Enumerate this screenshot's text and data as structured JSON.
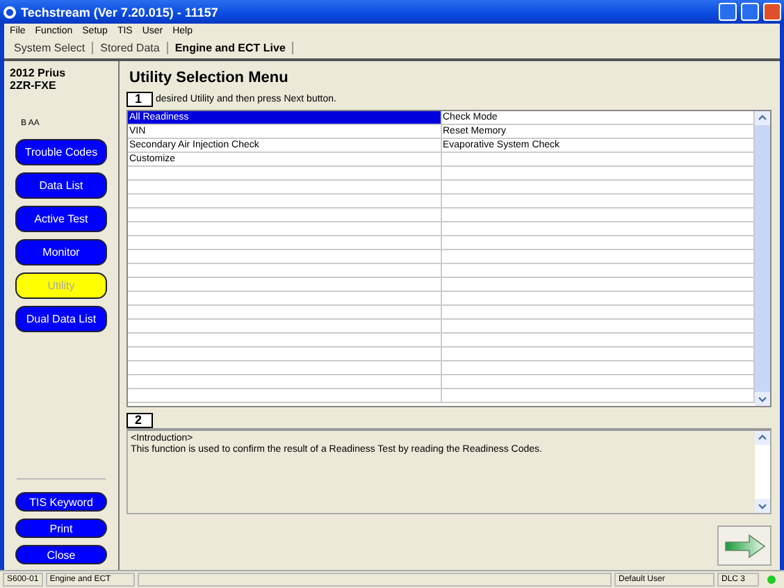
{
  "window": {
    "title": "Techstream (Ver 7.20.015) - 11157"
  },
  "menu": [
    "File",
    "Function",
    "Setup",
    "TIS",
    "User",
    "Help"
  ],
  "tabs": [
    {
      "label": "System Select",
      "selected": false
    },
    {
      "label": "Stored Data",
      "selected": false
    },
    {
      "label": "Engine and ECT Live",
      "selected": true
    }
  ],
  "vehicle": {
    "model": "2012 Prius",
    "engine": "2ZR-FXE",
    "code": "B AA"
  },
  "sidebar": {
    "items": [
      {
        "label": "Trouble Codes",
        "selected": false
      },
      {
        "label": "Data List",
        "selected": false
      },
      {
        "label": "Active Test",
        "selected": false
      },
      {
        "label": "Monitor",
        "selected": false
      },
      {
        "label": "Utility",
        "selected": true
      },
      {
        "label": "Dual Data List",
        "selected": false
      }
    ],
    "bottom_buttons": [
      "TIS Keyword",
      "Print",
      "Close"
    ]
  },
  "content": {
    "title": "Utility Selection Menu",
    "badge_1": "1",
    "instruction": "desired Utility and then press Next button.",
    "badge_2": "2"
  },
  "table": {
    "rows": [
      {
        "cells": [
          {
            "text": "All Readiness",
            "selected": true
          },
          {
            "text": "Check Mode",
            "selected": false
          }
        ]
      },
      {
        "cells": [
          {
            "text": "VIN",
            "selected": false
          },
          {
            "text": "Reset Memory",
            "selected": false
          }
        ]
      },
      {
        "cells": [
          {
            "text": "Secondary Air Injection Check",
            "selected": false
          },
          {
            "text": "Evaporative System Check",
            "selected": false
          }
        ]
      },
      {
        "cells": [
          {
            "text": "Customize",
            "selected": false
          }
        ]
      }
    ]
  },
  "description": {
    "heading": "<Introduction>",
    "text": "This function is used to confirm the result of a Readiness Test by reading the Readiness Codes."
  },
  "status_bar": {
    "code": "S600-01",
    "system": "Engine and ECT",
    "user": "Default User",
    "interface": "DLC 3",
    "indicator": {
      "color": "#22cc22"
    }
  }
}
